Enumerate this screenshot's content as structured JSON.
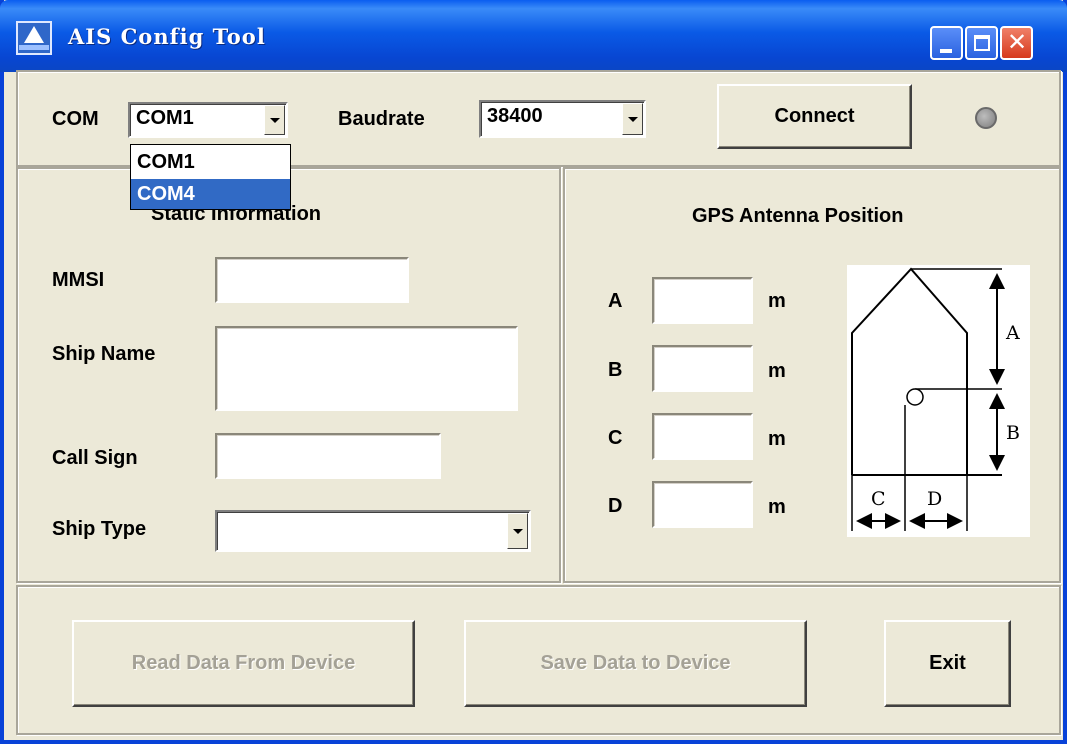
{
  "window": {
    "title": "AIS Config Tool",
    "icon": "ais-app-icon",
    "controls": [
      "minimize-icon",
      "maximize-icon",
      "close-icon"
    ],
    "close_glyph": "✕"
  },
  "connection": {
    "com_label": "COM",
    "com_value": "COM1",
    "com_options": [
      "COM1",
      "COM4"
    ],
    "com_highlighted": "COM4",
    "baudrate_label": "Baudrate",
    "baudrate_value": "38400",
    "connect_label": "Connect",
    "status_led_color": "#8a8a8a"
  },
  "static_info": {
    "title": "Static Information",
    "mmsi_label": "MMSI",
    "mmsi_value": "",
    "ship_name_label": "Ship Name",
    "ship_name_value": "",
    "call_sign_label": "Call Sign",
    "call_sign_value": "",
    "ship_type_label": "Ship Type",
    "ship_type_value": ""
  },
  "gps": {
    "title": "GPS Antenna Position",
    "fields": [
      {
        "label": "A",
        "value": "",
        "unit": "m"
      },
      {
        "label": "B",
        "value": "",
        "unit": "m"
      },
      {
        "label": "C",
        "value": "",
        "unit": "m"
      },
      {
        "label": "D",
        "value": "",
        "unit": "m"
      }
    ],
    "diagram_labels": {
      "a": "A",
      "b": "B",
      "c": "C",
      "d": "D"
    }
  },
  "actions": {
    "read_label": "Read Data From Device",
    "save_label": "Save Data to Device",
    "exit_label": "Exit"
  }
}
